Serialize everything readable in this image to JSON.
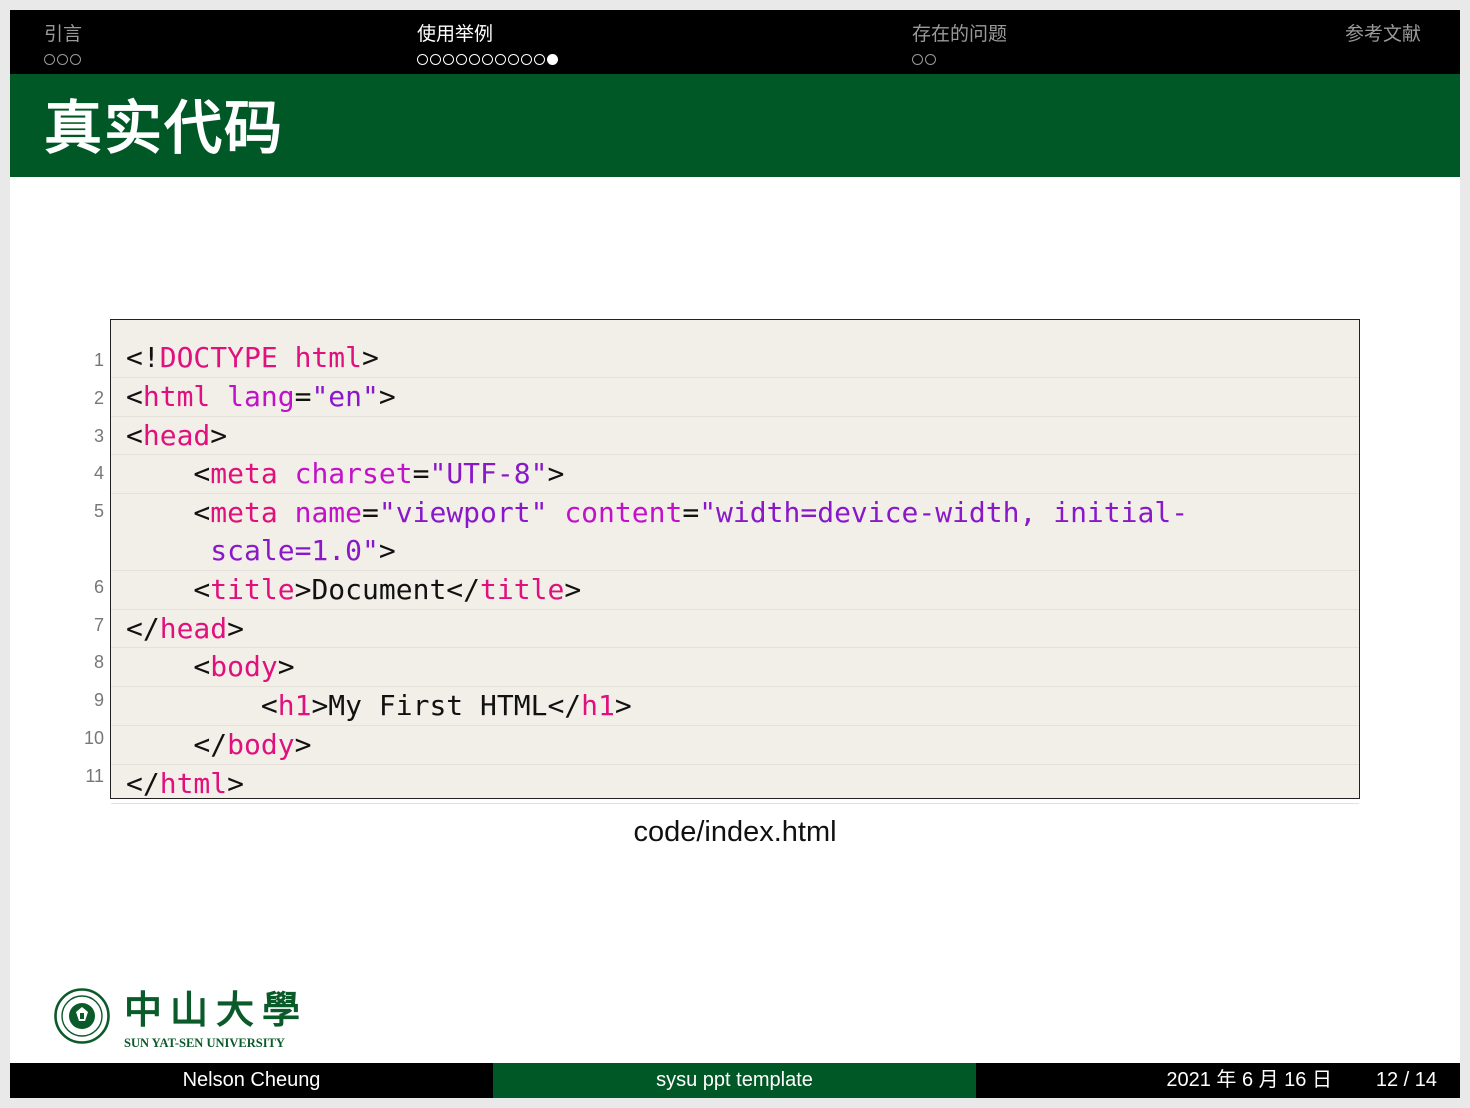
{
  "nav": {
    "sections": [
      {
        "title": "引言",
        "dots": 3,
        "filled": -1
      },
      {
        "title": "使用举例",
        "dots": 11,
        "filled": 10
      },
      {
        "title": "存在的问题",
        "dots": 2,
        "filled": -1
      },
      {
        "title": "参考文献",
        "dots": 0,
        "filled": -1
      }
    ]
  },
  "slide_title": "真实代码",
  "code": {
    "line_numbers": [
      "1",
      "2",
      "3",
      "4",
      "5",
      "6",
      "7",
      "8",
      "9",
      "10",
      "11"
    ],
    "caption": "code/index.html"
  },
  "logo": {
    "chinese": "中山大學",
    "english": "SUN YAT-SEN UNIVERSITY"
  },
  "footer": {
    "author": "Nelson Cheung",
    "title": "sysu ppt template",
    "date": "2021 年 6 月 16 日",
    "page": "12 / 14"
  },
  "colors": {
    "green": "#005826",
    "tag": "#e0107c",
    "attribute": "#c311c9",
    "string": "#8a18c9"
  }
}
